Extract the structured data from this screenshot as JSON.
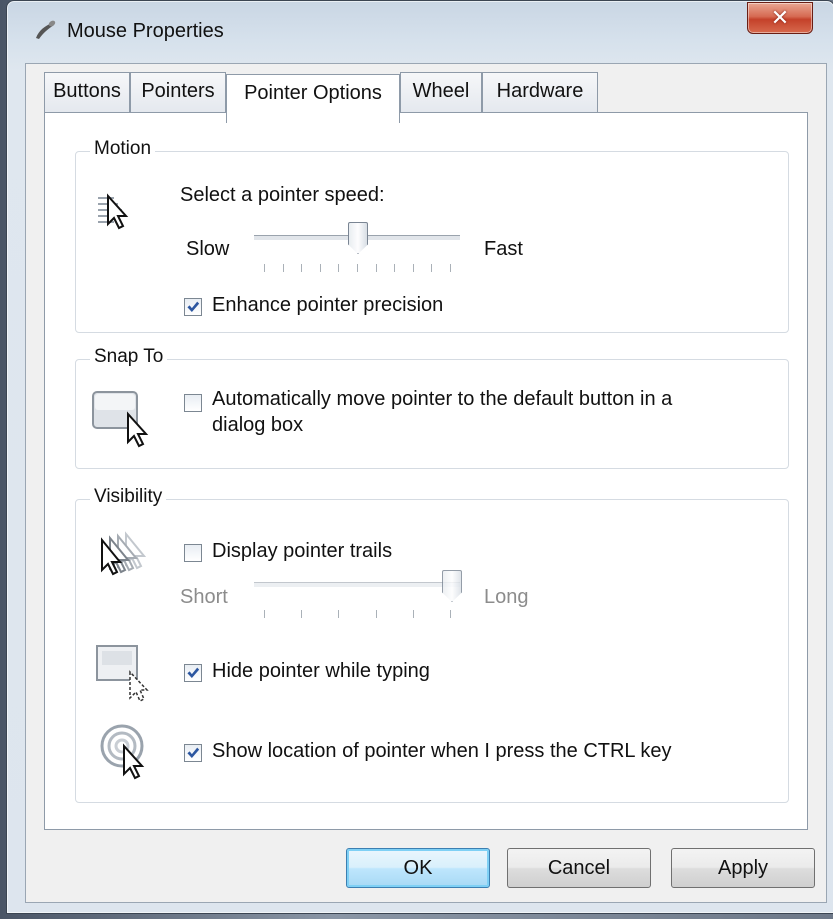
{
  "window": {
    "title": "Mouse Properties",
    "close_glyph": "✕"
  },
  "tabs": [
    {
      "label": "Buttons",
      "active": false
    },
    {
      "label": "Pointers",
      "active": false
    },
    {
      "label": "Pointer Options",
      "active": true
    },
    {
      "label": "Wheel",
      "active": false
    },
    {
      "label": "Hardware",
      "active": false
    }
  ],
  "motion": {
    "group_label": "Motion",
    "speed_label": "Select a pointer speed:",
    "slow_label": "Slow",
    "fast_label": "Fast",
    "speed_value": 0.5,
    "enhance_label": "Enhance pointer precision",
    "enhance_checked": true,
    "icon": "pointer-speed-icon"
  },
  "snap_to": {
    "group_label": "Snap To",
    "auto_move_label_line1": "Automatically move pointer to the default button in a",
    "auto_move_label_line2": "dialog box",
    "auto_move_checked": false,
    "icon": "snap-to-icon"
  },
  "visibility": {
    "group_label": "Visibility",
    "trails_label": "Display pointer trails",
    "trails_checked": false,
    "short_label": "Short",
    "long_label": "Long",
    "trail_length_value": 1.0,
    "hide_label": "Hide pointer while typing",
    "hide_checked": true,
    "ctrl_label": "Show location of pointer when I press the CTRL key",
    "ctrl_checked": true,
    "icons": [
      "pointer-trails-icon",
      "hide-pointer-icon",
      "pointer-location-icon"
    ]
  },
  "buttons": {
    "ok": "OK",
    "cancel": "Cancel",
    "apply": "Apply"
  },
  "colors": {
    "check_accent": "#2c56a0",
    "close_red": "#c4412a",
    "default_button": "#3c7fb1"
  }
}
